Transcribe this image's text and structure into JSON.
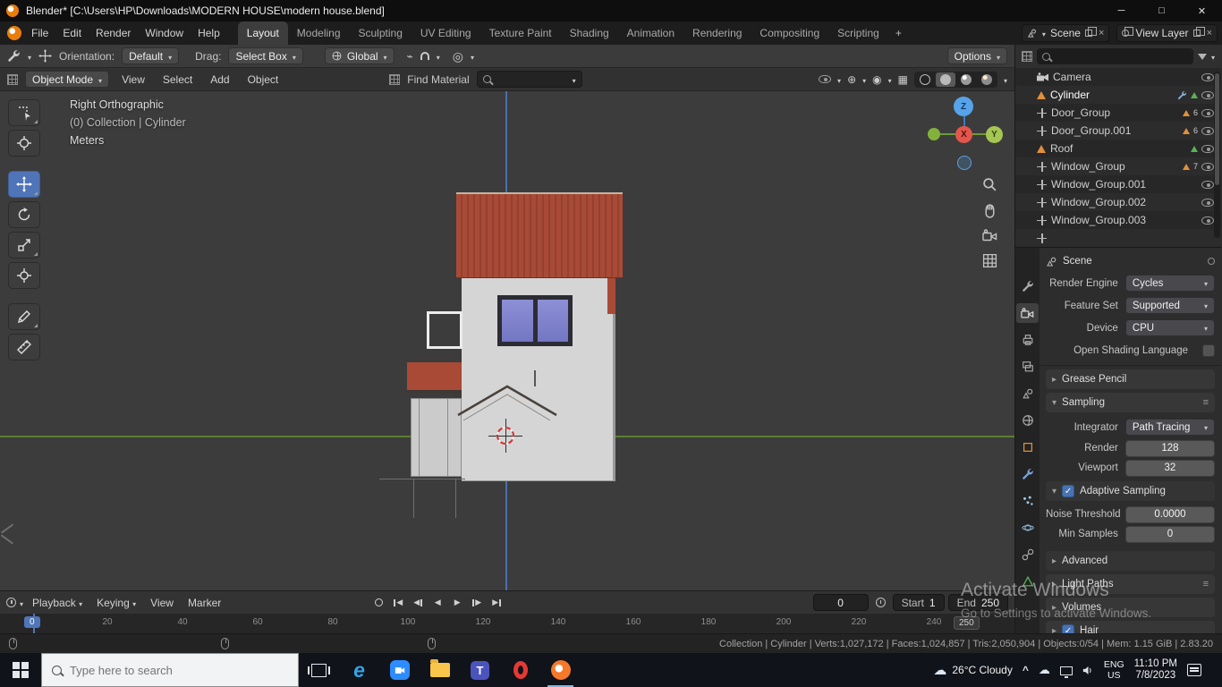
{
  "title_bar": {
    "title": "Blender* [C:\\Users\\HP\\Downloads\\MODERN HOUSE\\modern house.blend]"
  },
  "topbar": {
    "menus": [
      "File",
      "Edit",
      "Render",
      "Window",
      "Help"
    ],
    "workspaces": [
      "Layout",
      "Modeling",
      "Sculpting",
      "UV Editing",
      "Texture Paint",
      "Shading",
      "Animation",
      "Rendering",
      "Compositing",
      "Scripting"
    ],
    "add_workspace": "+",
    "scene": "Scene",
    "view_layer": "View Layer"
  },
  "tools_row": {
    "orientation_label": "Orientation:",
    "orientation_value": "Default",
    "drag_label": "Drag:",
    "drag_value": "Select Box",
    "transform_orientation": "Global",
    "options": "Options"
  },
  "vp_header": {
    "mode": "Object Mode",
    "menus": [
      "View",
      "Select",
      "Add",
      "Object"
    ],
    "find_material": "Find Material"
  },
  "viewport": {
    "overlay": [
      "Right Orthographic",
      "(0) Collection | Cylinder",
      "Meters"
    ],
    "gizmo": {
      "x": "X",
      "y": "Y",
      "z": "Z"
    }
  },
  "outliner": {
    "items": [
      {
        "name": "Camera",
        "icon": "camera"
      },
      {
        "name": "Cylinder",
        "icon": "mesh-object"
      },
      {
        "name": "Door_Group",
        "icon": "empty",
        "count": "6"
      },
      {
        "name": "Door_Group.001",
        "icon": "empty",
        "count": "6"
      },
      {
        "name": "Roof",
        "icon": "mesh-object"
      },
      {
        "name": "Window_Group",
        "icon": "empty",
        "count": "7"
      },
      {
        "name": "Window_Group.001",
        "icon": "empty"
      },
      {
        "name": "Window_Group.002",
        "icon": "empty"
      },
      {
        "name": "Window_Group.003",
        "icon": "empty"
      }
    ]
  },
  "properties": {
    "context": "Scene",
    "render_engine_label": "Render Engine",
    "render_engine": "Cycles",
    "feature_set_label": "Feature Set",
    "feature_set": "Supported",
    "device_label": "Device",
    "device": "CPU",
    "osl_label": "Open Shading Language",
    "grease_pencil": "Grease Pencil",
    "sampling": "Sampling",
    "integrator_label": "Integrator",
    "integrator": "Path Tracing",
    "render_label": "Render",
    "render_samples": "128",
    "viewport_label": "Viewport",
    "viewport_samples": "32",
    "adaptive": "Adaptive Sampling",
    "noise_label": "Noise Threshold",
    "noise": "0.0000",
    "min_samples_label": "Min Samples",
    "min_samples": "0",
    "advanced": "Advanced",
    "light_paths": "Light Paths",
    "volumes": "Volumes",
    "hair": "Hair"
  },
  "timeline": {
    "menus": [
      "Playback",
      "Keying",
      "View",
      "Marker"
    ],
    "frame": "0",
    "start_label": "Start",
    "start": "1",
    "end_label": "End",
    "end": "250",
    "playhead": "0",
    "end_marker": "250",
    "ticks": [
      "20",
      "40",
      "60",
      "80",
      "100",
      "120",
      "140",
      "160",
      "180",
      "200",
      "220",
      "240"
    ]
  },
  "status": {
    "info": "Collection | Cylinder | Verts:1,027,172 | Faces:1,024,857 | Tris:2,050,904 | Objects:0/54 | Mem: 1.15 GiB | 2.83.20"
  },
  "watermark": {
    "line1": "Activate Windows",
    "line2": "Go to Settings to activate Windows."
  },
  "taskbar": {
    "search_placeholder": "Type here to search",
    "weather": "26°C  Cloudy",
    "lang_line1": "ENG",
    "lang_line2": "US",
    "time": "11:10 PM",
    "date": "7/8/2023"
  },
  "colors": {
    "accent_blue": "#4772b3",
    "blender_orange": "#e87d0d",
    "roof_red": "#a84a36",
    "axis_green": "#6e9b39",
    "axis_blue": "#4178c2"
  },
  "icons": {
    "caret_down": "▾",
    "collapsed": "▸",
    "check": "✓",
    "cloud": "☁",
    "close": "×"
  }
}
